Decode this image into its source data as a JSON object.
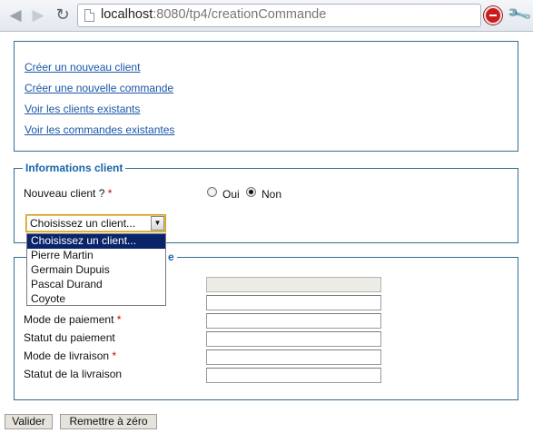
{
  "browser": {
    "url_host": "localhost",
    "url_rest": ":8080/tp4/creationCommande"
  },
  "nav_links": [
    "Créer un nouveau client",
    "Créer une nouvelle commande",
    "Voir les clients existants",
    "Voir les commandes existantes"
  ],
  "client_section": {
    "legend": "Informations client",
    "new_client_label": "Nouveau client ?",
    "required_mark": "*",
    "radio_yes": "Oui",
    "radio_no": "Non",
    "radio_selected": "Non",
    "select_value": "Choisissez un client...",
    "select_options": [
      "Choisissez un client...",
      "Pierre Martin",
      "Germain Dupuis",
      "Pascal Durand",
      "Coyote"
    ]
  },
  "order_section": {
    "legend_visible_suffix": "e",
    "fields": [
      {
        "label": "",
        "value": ""
      },
      {
        "label": "",
        "value": ""
      },
      {
        "label": "Mode de paiement",
        "required": true,
        "value": ""
      },
      {
        "label": "Statut du paiement",
        "required": false,
        "value": ""
      },
      {
        "label": "Mode de livraison",
        "required": true,
        "value": ""
      },
      {
        "label": "Statut de la livraison",
        "required": false,
        "value": ""
      }
    ]
  },
  "buttons": {
    "submit": "Valider",
    "reset": "Remettre à zéro"
  },
  "colors": {
    "border": "#2f6f8f",
    "legend": "#1565a8",
    "link": "#1a56a8",
    "required": "#cc0000",
    "selection": "#0a246a"
  }
}
